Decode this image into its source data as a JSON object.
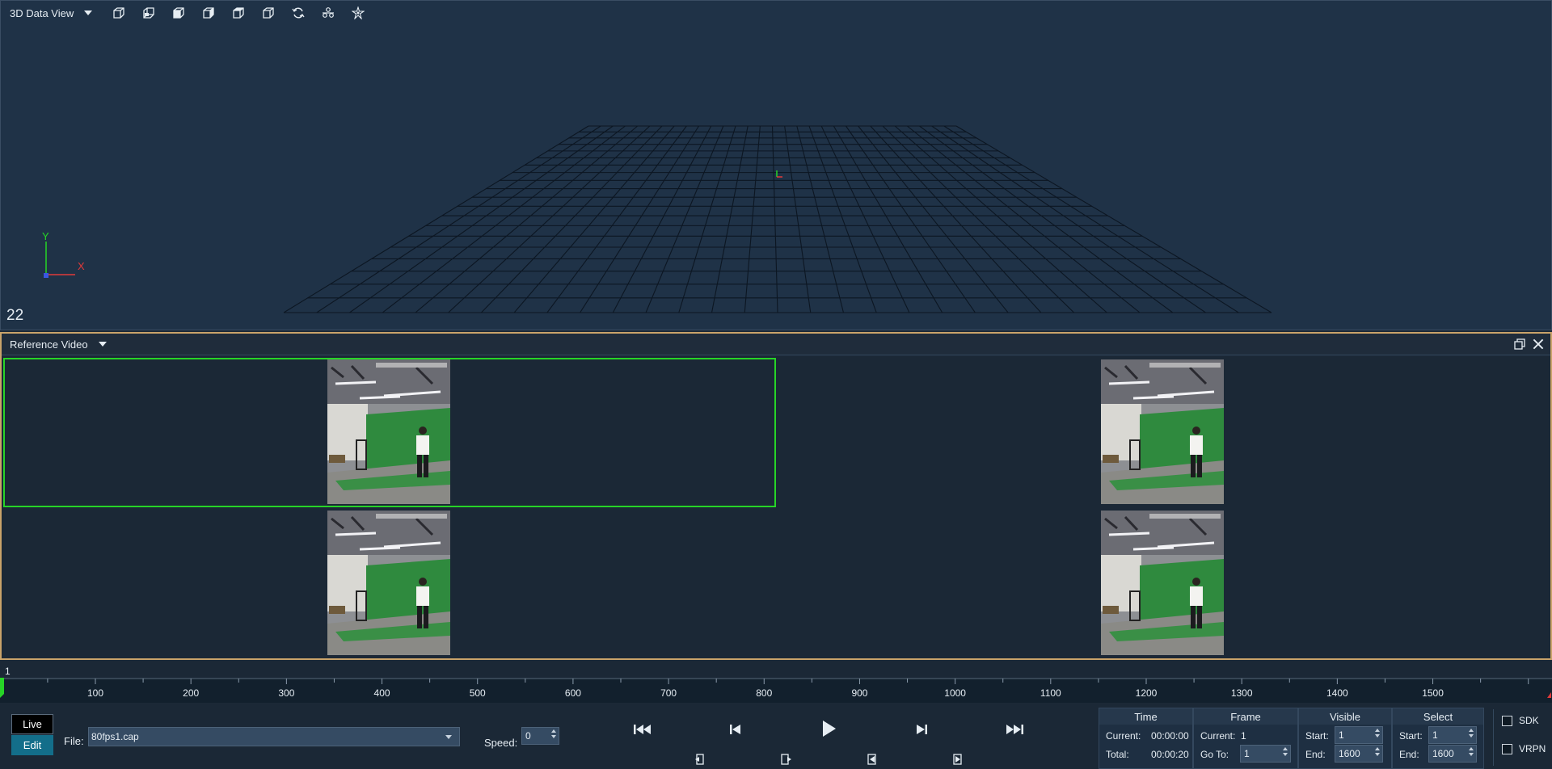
{
  "view3d": {
    "title": "3D Data View",
    "toolbar_icons": [
      "view-front-icon",
      "view-back-icon",
      "view-left-icon",
      "view-right-icon",
      "view-top-icon",
      "view-bottom-icon",
      "reset-view-icon",
      "tracking-icon",
      "markers-icon"
    ],
    "frame_number": "22",
    "axis": {
      "x": "X",
      "y": "Y"
    }
  },
  "reference_video": {
    "title": "Reference Video",
    "cameras": [
      "camera-1",
      "camera-2",
      "camera-3",
      "camera-4"
    ]
  },
  "timeline": {
    "start_label": "1",
    "ticks": [
      "100",
      "200",
      "300",
      "400",
      "500",
      "600",
      "700",
      "800",
      "900",
      "1000",
      "1100",
      "1200",
      "1300",
      "1400",
      "1500"
    ]
  },
  "controls": {
    "live_label": "Live",
    "edit_label": "Edit",
    "file_label": "File:",
    "file_value": "80fps1.cap",
    "speed_label": "Speed:",
    "speed_value": "0"
  },
  "info": {
    "time": {
      "header": "Time",
      "current_label": "Current:",
      "current_value": "00:00:00",
      "total_label": "Total:",
      "total_value": "00:00:20"
    },
    "frame": {
      "header": "Frame",
      "current_label": "Current:",
      "current_value": "1",
      "goto_label": "Go To:",
      "goto_value": "1"
    },
    "visible": {
      "header": "Visible",
      "start_label": "Start:",
      "start_value": "1",
      "end_label": "End:",
      "end_value": "1600"
    },
    "select": {
      "header": "Select",
      "start_label": "Start:",
      "start_value": "1",
      "end_label": "End:",
      "end_value": "1600"
    }
  },
  "checkboxes": {
    "sdk_label": "SDK",
    "vrpn_label": "VRPN",
    "sdk_checked": false,
    "vrpn_checked": false
  },
  "colors": {
    "accent_green": "#27d427",
    "panel_border": "#c9a36a",
    "edit_button": "#136e8a"
  }
}
